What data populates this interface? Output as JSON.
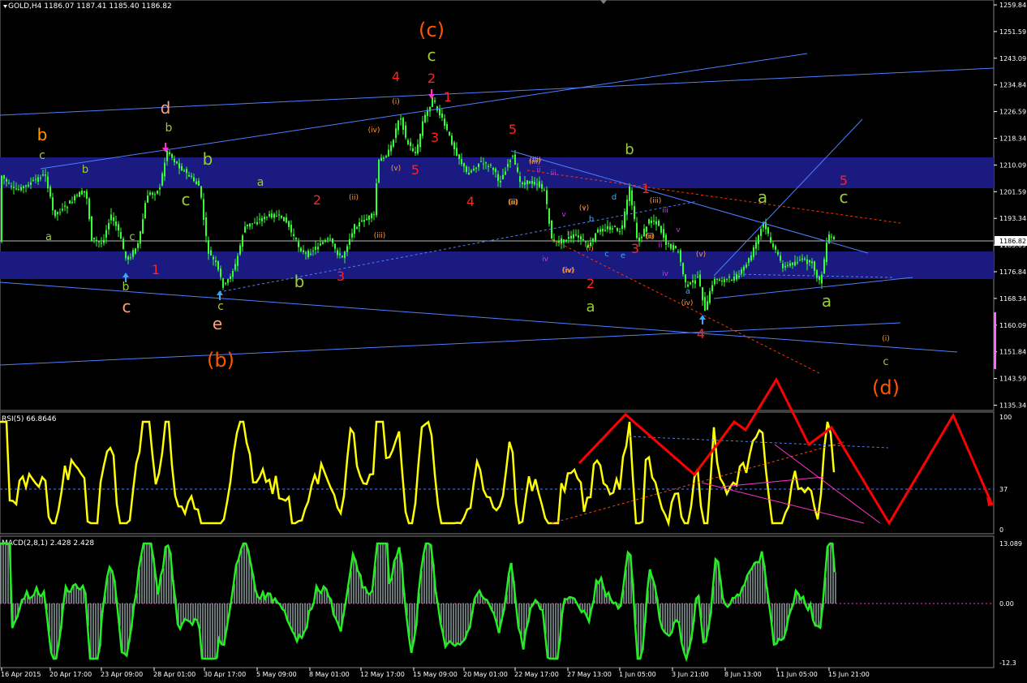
{
  "header": {
    "main": "GOLD,H4  1186.07 1187.41 1185.40 1186.82",
    "rsi": "RSI(5) 66.8646",
    "macd": "MACD(2,8,1) 2.428 2.428"
  },
  "price_axis": [
    "1259.84",
    "1251.59",
    "1243.09",
    "1234.84",
    "1226.59",
    "1218.34",
    "1210.09",
    "1201.59",
    "1193.34",
    "1185.09",
    "1176.84",
    "1168.34",
    "1160.09",
    "1151.84",
    "1143.59",
    "1135.34"
  ],
  "current_price": "1186.82",
  "rsi_axis": [
    "100",
    "37",
    "0"
  ],
  "macd_axis": [
    "13.089",
    "0.00",
    "-12.3"
  ],
  "time_axis": [
    "16 Apr 2015",
    "20 Apr 17:00",
    "23 Apr 09:00",
    "28 Apr 01:00",
    "30 Apr 17:00",
    "5 May 09:00",
    "8 May 01:00",
    "12 May 17:00",
    "15 May 09:00",
    "20 May 01:00",
    "22 May 17:00",
    "27 May 13:00",
    "1 Jun 05:00",
    "3 Jun 21:00",
    "8 Jun 13:00",
    "11 Jun 05:00",
    "15 Jun 21:00"
  ],
  "colors": {
    "bg": "#000000",
    "candles": "#33ff33",
    "zone": "#1a1a80",
    "trend": "#4f7fff",
    "rsi": "#ffff00",
    "macd_line": "#22ee22",
    "macd_hist": "#8a9a9a",
    "red": "#ff2222",
    "orange": "#ff5500",
    "green_label": "#9acd32",
    "salmon": "#ffa07a"
  },
  "wave_labels": [
    {
      "t": "(c)",
      "c": "#ff5500",
      "s": 24
    },
    {
      "t": "(b)",
      "c": "#ff5500",
      "s": 24
    },
    {
      "t": "(d)",
      "c": "#ff5500",
      "s": 24
    },
    {
      "t": "b",
      "c": "#ff9900",
      "s": 20
    },
    {
      "t": "d",
      "c": "#ffa07a",
      "s": 20
    },
    {
      "t": "c",
      "c": "#ffa07a",
      "s": 20
    },
    {
      "t": "e",
      "c": "#ffa07a",
      "s": 20
    },
    {
      "t": "c",
      "c": "#9acd32",
      "s": 14
    },
    {
      "t": "b",
      "c": "#9acd32",
      "s": 14
    },
    {
      "t": "c",
      "c": "#9acd32",
      "s": 14
    },
    {
      "t": "b",
      "c": "#9acd32",
      "s": 14
    },
    {
      "t": "a",
      "c": "#9acd32",
      "s": 14
    },
    {
      "t": "a",
      "c": "#9acd32",
      "s": 13
    },
    {
      "t": "b",
      "c": "#9acd32",
      "s": 13
    },
    {
      "t": "c",
      "c": "#9acd32",
      "s": 13
    },
    {
      "t": "a",
      "c": "#9acd32",
      "s": 18
    },
    {
      "t": "b",
      "c": "#9acd32",
      "s": 18
    },
    {
      "t": "c",
      "c": "#9acd32",
      "s": 13
    },
    {
      "t": "c",
      "c": "#9acd32",
      "s": 20
    },
    {
      "t": "b",
      "c": "#9acd32",
      "s": 20
    },
    {
      "t": "a",
      "c": "#9acd32",
      "s": 20
    },
    {
      "t": "a",
      "c": "#9acd32",
      "s": 20
    },
    {
      "t": "c",
      "c": "#9acd32",
      "s": 20
    },
    {
      "t": "b",
      "c": "#9acd32",
      "s": 20
    },
    {
      "t": "c",
      "c": "#9acd32",
      "s": 20
    },
    {
      "t": "1",
      "c": "#ff2222",
      "s": 16
    },
    {
      "t": "2",
      "c": "#ff2222",
      "s": 16
    },
    {
      "t": "3",
      "c": "#ff2222",
      "s": 16
    },
    {
      "t": "4",
      "c": "#ff2222",
      "s": 16
    },
    {
      "t": "5",
      "c": "#ff2222",
      "s": 16
    },
    {
      "t": "2",
      "c": "#ff2222",
      "s": 16
    },
    {
      "t": "1",
      "c": "#ff2222",
      "s": 16
    },
    {
      "t": "3",
      "c": "#ff2222",
      "s": 16
    },
    {
      "t": "4",
      "c": "#ff2222",
      "s": 16
    },
    {
      "t": "5",
      "c": "#ff2222",
      "s": 16
    },
    {
      "t": "2",
      "c": "#ff2222",
      "s": 16
    },
    {
      "t": "1",
      "c": "#ff2222",
      "s": 16
    },
    {
      "t": "3",
      "c": "#ff2222",
      "s": 16
    },
    {
      "t": "4",
      "c": "#ff2222",
      "s": 16
    },
    {
      "t": "5",
      "c": "#ff2222",
      "s": 16
    },
    {
      "t": "(i)",
      "c": "#ff9933",
      "s": 9
    },
    {
      "t": "(ii)",
      "c": "#ff9933",
      "s": 9
    },
    {
      "t": "(iii)",
      "c": "#ff9933",
      "s": 9
    },
    {
      "t": "(iv)",
      "c": "#ff9933",
      "s": 9
    },
    {
      "t": "(v)",
      "c": "#ff9933",
      "s": 9
    },
    {
      "t": "(i)",
      "c": "#ff9933",
      "s": 9
    },
    {
      "t": "(ii)",
      "c": "#ff9933",
      "s": 9
    },
    {
      "t": "(iii)",
      "c": "#ff9933",
      "s": 9
    },
    {
      "t": "(iv)",
      "c": "#ff9933",
      "s": 9
    },
    {
      "t": "(v)",
      "c": "#ff9933",
      "s": 9
    },
    {
      "t": "(i)",
      "c": "#ff9933",
      "s": 9
    },
    {
      "t": "(ii)",
      "c": "#ff9933",
      "s": 9
    },
    {
      "t": "(iii)",
      "c": "#ff9933",
      "s": 9
    },
    {
      "t": "(iv)",
      "c": "#ff9933",
      "s": 9
    },
    {
      "t": "(v)",
      "c": "#ff9933",
      "s": 9
    },
    {
      "t": "(i)",
      "c": "#ff9933",
      "s": 9
    },
    {
      "t": "(ii)",
      "c": "#ff9933",
      "s": 9
    },
    {
      "t": "(iii)",
      "c": "#ff9933",
      "s": 9
    },
    {
      "t": "(iv)",
      "c": "#ff9933",
      "s": 9
    },
    {
      "t": "i",
      "c": "#cc33ff",
      "s": 9
    },
    {
      "t": "ii",
      "c": "#cc33ff",
      "s": 9
    },
    {
      "t": "iii",
      "c": "#cc33ff",
      "s": 9
    },
    {
      "t": "iv",
      "c": "#cc33ff",
      "s": 9
    },
    {
      "t": "v",
      "c": "#cc33ff",
      "s": 9
    },
    {
      "t": "i",
      "c": "#cc33ff",
      "s": 9
    },
    {
      "t": "ii",
      "c": "#cc33ff",
      "s": 9
    },
    {
      "t": "iii",
      "c": "#cc33ff",
      "s": 9
    },
    {
      "t": "iv",
      "c": "#cc33ff",
      "s": 9
    },
    {
      "t": "v",
      "c": "#cc33ff",
      "s": 9
    },
    {
      "t": "a",
      "c": "#33aaff",
      "s": 10
    },
    {
      "t": "b",
      "c": "#33aaff",
      "s": 10
    },
    {
      "t": "c",
      "c": "#33aaff",
      "s": 10
    },
    {
      "t": "d",
      "c": "#33aaff",
      "s": 10
    },
    {
      "t": "e",
      "c": "#33aaff",
      "s": 10
    }
  ]
}
